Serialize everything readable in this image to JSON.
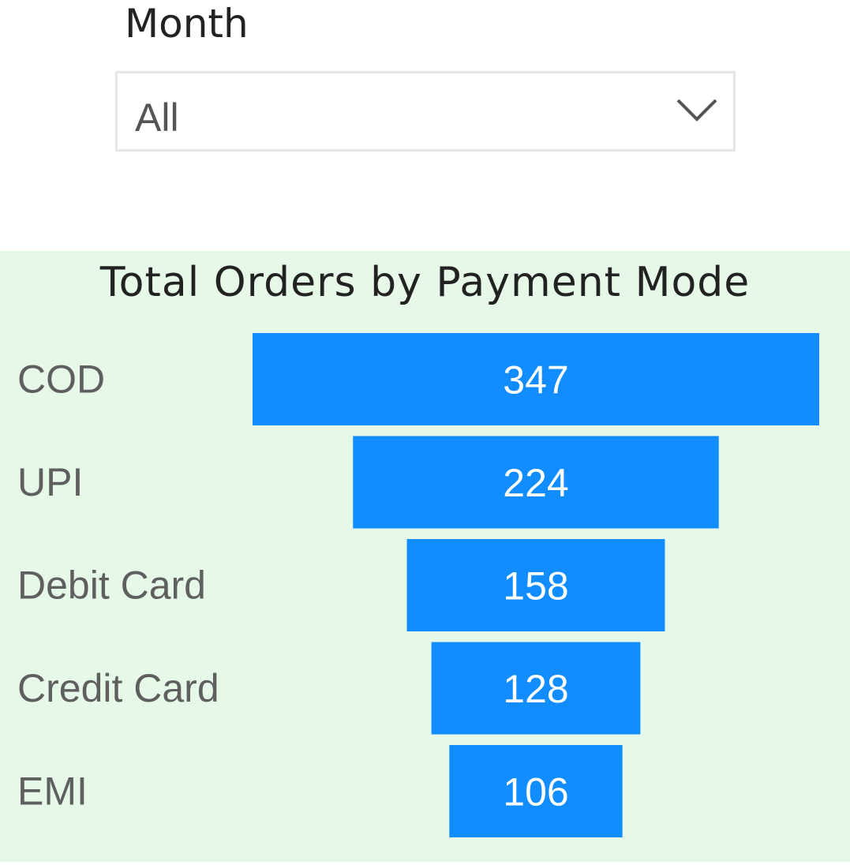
{
  "slicer": {
    "title": "Month",
    "selected": "All"
  },
  "colors": {
    "bar": "#118dff",
    "panel_background": "#e6f9e8",
    "label_text": "#5f5f5f",
    "value_text": "#ffffff"
  },
  "chart_data": {
    "type": "bar",
    "orientation": "funnel",
    "title": "Total Orders by Payment Mode",
    "categories": [
      "COD",
      "UPI",
      "Debit Card",
      "Credit Card",
      "EMI"
    ],
    "values": [
      347,
      224,
      158,
      128,
      106
    ],
    "data_labels": true,
    "grid": false
  }
}
